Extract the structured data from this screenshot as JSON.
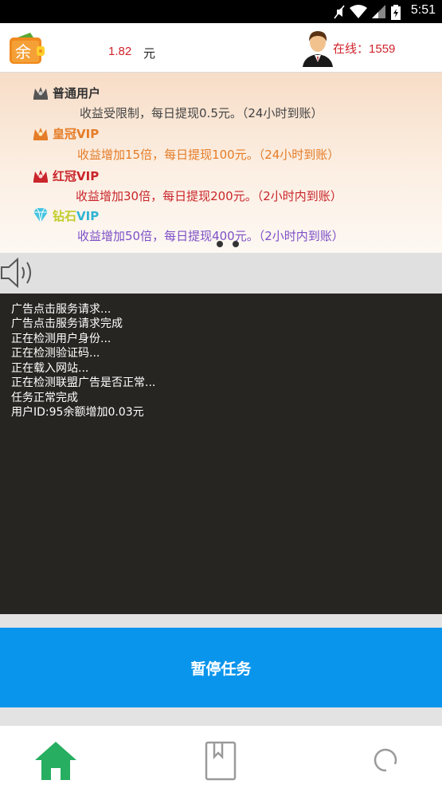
{
  "status_bar": {
    "time": "5:51"
  },
  "header": {
    "balance": "1.82",
    "balance_unit": "元",
    "online_label": "在线：",
    "online_count": "1559"
  },
  "banner": {
    "tiers": [
      {
        "name": "普通用户",
        "color": "#333333",
        "desc": "收益受限制，每日提现0.5元。（24小时到账）",
        "desc_color": "#444444"
      },
      {
        "name": "皇冠VIP",
        "color": "#e57c27",
        "desc": "收益增加15倍，每日提现100元。（24小时到账）",
        "desc_color": "#e57c27"
      },
      {
        "name": "红冠VIP",
        "color": "#c9252b",
        "desc": "收益增加30倍，每日提现200元。（2小时内到账）",
        "desc_color": "#c9252b"
      },
      {
        "name": "钻石VIP",
        "color": "#2fb4d3",
        "desc": "收益增加50倍，每日提现400元。（2小时内到账）",
        "desc_color": "#7d4fc7"
      }
    ]
  },
  "console": {
    "lines": [
      "广告点击服务请求...",
      "广告点击服务请求完成",
      "正在检测用户身份...",
      "正在检测验证码...",
      "正在载入网站...",
      "正在检测联盟广告是否正常...",
      "任务正常完成",
      "用户ID:95余额增加0.03元"
    ]
  },
  "action_button": {
    "label": "暂停任务"
  },
  "colors": {
    "accent": "#0a95ec",
    "nav_active": "#27ae60"
  },
  "bottom_nav": {
    "icons": [
      "home-icon",
      "bookmark-icon",
      "profile-icon"
    ]
  }
}
